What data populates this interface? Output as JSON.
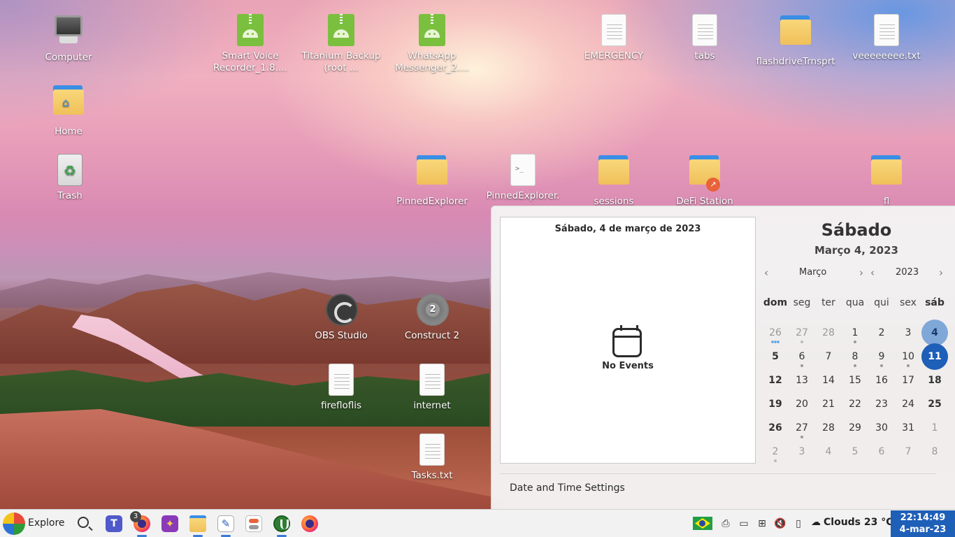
{
  "desktop": {
    "icons": {
      "computer": "Computer",
      "home": "Home",
      "trash": "Trash",
      "smart_voice": "Smart Voice Recorder_1.8....",
      "titanium": "Titanium Backup (root ...",
      "whatsapp": "WhatsApp Messenger_2....",
      "emergency": "EMERGENCY",
      "tabs": "tabs",
      "flashdrive": "flashdriveTrnsprt",
      "veeeeeeee": "veeeeeeee.txt",
      "pinned_explorer": "PinnedExplorer",
      "pinned_explorer_sh": "PinnedExplorer.",
      "sessions": "sessions",
      "defi": "DeFi Station",
      "fl": "fl",
      "obs": "OBS Studio",
      "construct": "Construct 2",
      "fireflo": "firefloflis",
      "internet": "internet",
      "tasks": "Tasks.txt"
    }
  },
  "calendar_popup": {
    "events_header": "Sábado, 4 de março de 2023",
    "no_events": "No Events",
    "weekday": "Sábado",
    "full_date": "Março 4, 2023",
    "month": "Março",
    "year": "2023",
    "prev_arrow": "‹",
    "next_arrow": "›",
    "weekdays": [
      "dom",
      "seg",
      "ter",
      "qua",
      "qui",
      "sex",
      "sáb"
    ],
    "weeks": [
      [
        "26",
        "27",
        "28",
        "1",
        "2",
        "3",
        "4"
      ],
      [
        "5",
        "6",
        "7",
        "8",
        "9",
        "10",
        "11"
      ],
      [
        "12",
        "13",
        "14",
        "15",
        "16",
        "17",
        "18"
      ],
      [
        "19",
        "20",
        "21",
        "22",
        "23",
        "24",
        "25"
      ],
      [
        "26",
        "27",
        "28",
        "29",
        "30",
        "31",
        "1"
      ],
      [
        "2",
        "3",
        "4",
        "5",
        "6",
        "7",
        "8"
      ]
    ],
    "settings_link": "Date and Time Settings",
    "accent_color": "#1e5fb8",
    "selected_color": "#7fa8d8"
  },
  "taskbar": {
    "explore_label": "Explore",
    "firefox_badge": "3",
    "teams_letter": "T",
    "weather_icon": "☁",
    "weather_text": "Clouds 23 °C",
    "time": "22:14:49",
    "date": "4-mar-23",
    "accent_color": "#1e5fb8"
  }
}
